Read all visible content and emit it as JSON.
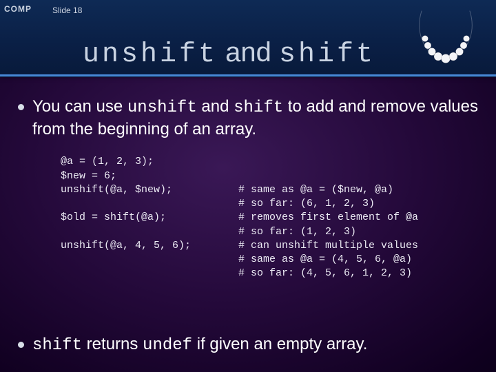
{
  "logo_text": "COMP",
  "slide_label": "Slide 18",
  "title": {
    "code1": "unshift",
    "connector": " and ",
    "code2": "shift"
  },
  "bullet1": {
    "t0": "You can use ",
    "c1": "unshift",
    "t1": " and ",
    "c2": " shift",
    "t2": " to add and remove values from the beginning of an array."
  },
  "code_left": "@a = (1, 2, 3);\n$new = 6;\nunshift(@a, $new);\n\n$old = shift(@a);\n\nunshift(@a, 4, 5, 6);",
  "code_right": "\n\n# same as @a = ($new, @a)\n# so far: (6, 1, 2, 3)\n# removes first element of @a\n# so far: (1, 2, 3)\n# can unshift multiple values\n# same as @a = (4, 5, 6, @a)\n# so far: (4, 5, 6, 1, 2, 3)",
  "bullet2": {
    "c1": "shift",
    "t1": " returns ",
    "c2": "undef",
    "t2": " if given an empty array."
  }
}
